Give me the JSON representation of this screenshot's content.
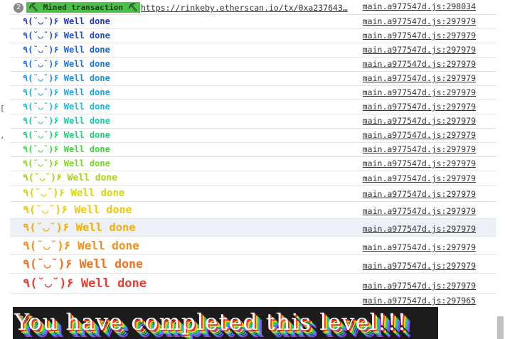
{
  "header_row": {
    "count": "2",
    "mined_label": "⛏ Mined transaction ⛏",
    "tx_link": "https://rinkeby.etherscan.io/tx/0xa237643…",
    "source": "main.a977547d.js:298034"
  },
  "log_rows": [
    {
      "text": "٩(˘◡˘)۶ Well done",
      "source": "main.a977547d.js:297979",
      "color": "#2435b8"
    },
    {
      "text": "٩(˘◡˘)۶ Well done",
      "source": "main.a977547d.js:297979",
      "color": "#1f4fc4"
    },
    {
      "text": "٩(˘◡˘)۶ Well done",
      "source": "main.a977547d.js:297979",
      "color": "#1a63d4"
    },
    {
      "text": "٩(˘◡˘)۶ Well done",
      "source": "main.a977547d.js:297979",
      "color": "#1a78e0"
    },
    {
      "text": "٩(˘◡˘)۶ Well done",
      "source": "main.a977547d.js:297979",
      "color": "#1a8fe6"
    },
    {
      "text": "٩(˘◡˘)۶ Well done",
      "source": "main.a977547d.js:297979",
      "color": "#1aa6e6"
    },
    {
      "text": "٩(˘◡˘)۶ Well done",
      "source": "main.a977547d.js:297979",
      "color": "#1ab8e0"
    },
    {
      "text": "٩(˘◡˘)۶ Well done",
      "source": "main.a977547d.js:297979",
      "color": "#16c9a8"
    },
    {
      "text": "٩(˘◡˘)۶ Well done",
      "source": "main.a977547d.js:297979",
      "color": "#1fcf74"
    },
    {
      "text": "٩(˘◡˘)۶ Well done",
      "source": "main.a977547d.js:297979",
      "color": "#3fd43c"
    },
    {
      "text": "٩(˘◡˘)۶ Well done",
      "source": "main.a977547d.js:297979",
      "color": "#7ad61e"
    },
    {
      "text": "٩(˘◡˘)۶ Well done",
      "source": "main.a977547d.js:297979",
      "color": "#a6d60e"
    },
    {
      "text": "٩(˘◡˘)۶ Well done",
      "source": "main.a977547d.js:297979",
      "color": "#d6d60a"
    },
    {
      "text": "٩(˘◡˘)۶ Well done",
      "source": "main.a977547d.js:297979",
      "color": "#f2c80a"
    },
    {
      "text": "٩(˘◡˘)۶ Well done",
      "source": "main.a977547d.js:297979",
      "color": "#f4ae0a"
    },
    {
      "text": "٩(˘◡˘)۶ Well done",
      "source": "main.a977547d.js:297979",
      "color": "#f5901a"
    },
    {
      "text": "٩(˘◡˘)۶ Well done",
      "source": "main.a977547d.js:297979",
      "color": "#f2701e"
    },
    {
      "text": "٩(˘◡˘)۶ Well done",
      "source": "main.a977547d.js:297979",
      "color": "#ee3a2e"
    }
  ],
  "final_row": {
    "source": "main.a977547d.js:297965"
  },
  "banner": {
    "text": "You have completed this level!!!"
  }
}
